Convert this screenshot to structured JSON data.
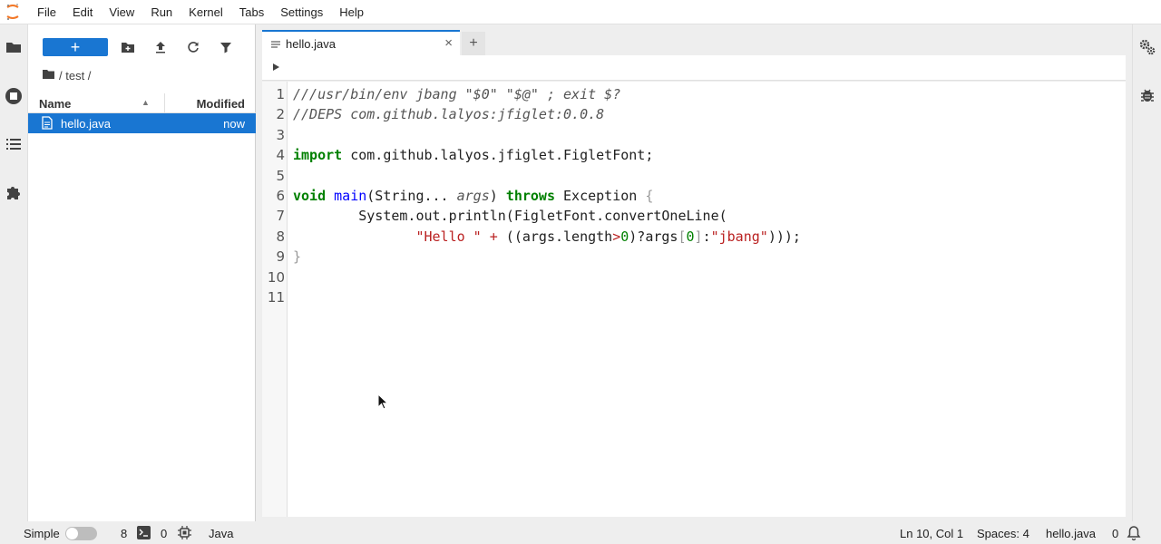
{
  "menubar": {
    "items": [
      "File",
      "Edit",
      "View",
      "Run",
      "Kernel",
      "Tabs",
      "Settings",
      "Help"
    ]
  },
  "left_sidebar": {
    "icons": [
      "folder-icon",
      "running-stop-icon",
      "toc-list-icon",
      "extension-puzzle-icon"
    ]
  },
  "right_sidebar": {
    "icons": [
      "property-inspector-gears-icon",
      "debugger-bug-icon"
    ]
  },
  "filebrowser": {
    "new_label": "+",
    "breadcrumb": "/ test /",
    "columns": {
      "name": "Name",
      "modified": "Modified"
    },
    "files": [
      {
        "name": "hello.java",
        "modified": "now"
      }
    ]
  },
  "tabs": [
    {
      "label": "hello.java",
      "close": "×"
    }
  ],
  "add_tab_label": "+",
  "editor": {
    "lines": [
      {
        "n": "1",
        "parts": [
          [
            "cmt",
            "///usr/bin/env jbang \"$0\" \"$@\" ; exit $?"
          ]
        ]
      },
      {
        "n": "2",
        "parts": [
          [
            "cmt",
            "//DEPS com.github.lalyos:jfiglet:0.0.8"
          ]
        ]
      },
      {
        "n": "3",
        "parts": []
      },
      {
        "n": "4",
        "parts": [
          [
            "kw",
            "import"
          ],
          [
            "",
            " com.github.lalyos.jfiglet.FigletFont;"
          ]
        ]
      },
      {
        "n": "5",
        "parts": []
      },
      {
        "n": "6",
        "parts": [
          [
            "kw",
            "void"
          ],
          [
            "",
            " "
          ],
          [
            "def",
            "main"
          ],
          [
            "",
            "(String... "
          ],
          [
            "var",
            "args"
          ],
          [
            "",
            ") "
          ],
          [
            "kw",
            "throws"
          ],
          [
            "",
            " Exception "
          ],
          [
            "br",
            "{"
          ]
        ]
      },
      {
        "n": "7",
        "parts": [
          [
            "",
            "        System.out.println(FigletFont.convertOneLine("
          ]
        ]
      },
      {
        "n": "8",
        "parts": [
          [
            "",
            "               "
          ],
          [
            "str",
            "\"Hello \""
          ],
          [
            "",
            " "
          ],
          [
            "str",
            "+"
          ],
          [
            "",
            " ((args.length"
          ],
          [
            "str",
            ">"
          ],
          [
            "num",
            "0"
          ],
          [
            "",
            ")?args"
          ],
          [
            "br",
            "["
          ],
          [
            "num",
            "0"
          ],
          [
            "br",
            "]"
          ],
          [
            "",
            ":"
          ],
          [
            "str",
            "\"jbang\""
          ],
          [
            "",
            ")));"
          ]
        ]
      },
      {
        "n": "9",
        "parts": [
          [
            "br",
            "}"
          ]
        ]
      },
      {
        "n": "10",
        "parts": []
      },
      {
        "n": "11",
        "parts": []
      }
    ]
  },
  "statusbar": {
    "mode_label": "Simple",
    "terminals_count": "8",
    "kernels_count": "0",
    "language": "Java",
    "cursor_position": "Ln 10, Col 1",
    "spaces": "Spaces: 4",
    "filename": "hello.java",
    "notifications_count": "0"
  },
  "colors": {
    "accent": "#1976d2"
  }
}
